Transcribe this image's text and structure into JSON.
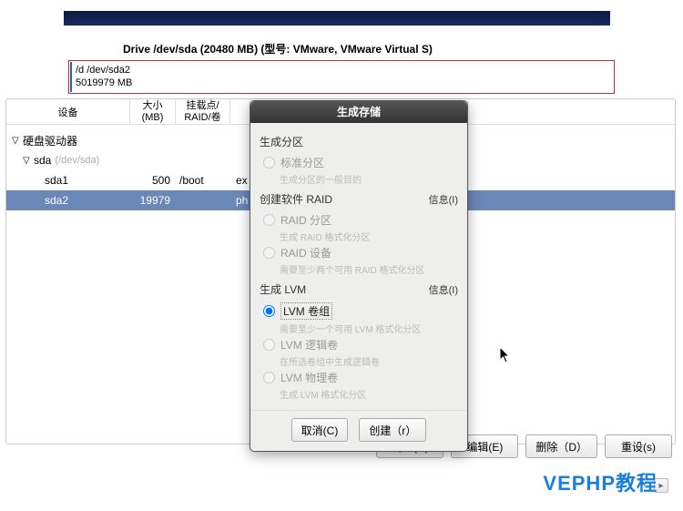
{
  "drive": {
    "title": "Drive /dev/sda (20480 MB) (型号: VMware, VMware Virtual S)",
    "line1": "/d /dev/sda2",
    "line2": "5019979 MB"
  },
  "columns": {
    "device": "设备",
    "size_l1": "大小",
    "size_l2": "(MB)",
    "mount_l1": "挂载点/",
    "mount_l2": "RAID/卷"
  },
  "tree": {
    "root": "硬盘驱动器",
    "sda": "sda",
    "sda_dev": "(/dev/sda)",
    "rows": [
      {
        "name": "sda1",
        "size": "500",
        "mount": "/boot",
        "type": "ex"
      },
      {
        "name": "sda2",
        "size": "19979",
        "mount": "",
        "type": "ph"
      }
    ]
  },
  "dialog": {
    "title": "生成存储",
    "sec1": "生成分区",
    "opt1": "标准分区",
    "opt1s": "生成分区的一般目的",
    "sec2": "创建软件 RAID",
    "info": "信息(I)",
    "opt2a": "RAID 分区",
    "opt2as": "生成 RAID 格式化分区",
    "opt2b": "RAID 设备",
    "opt2bs": "需要至少两个可用 RAID 格式化分区",
    "sec3": "生成 LVM",
    "opt3a": "LVM 卷组",
    "opt3as": "需要至少一个可用 LVM 格式化分区",
    "opt3b": "LVM 逻辑卷",
    "opt3bs": "在所选卷组中生成逻辑卷",
    "opt3c": "LVM 物理卷",
    "opt3cs": "生成 LVM 格式化分区",
    "cancel": "取消(C)",
    "create": "创建（r）"
  },
  "footer": {
    "create": "创建(C)",
    "edit": "编辑(E)",
    "delete": "删除（D）",
    "reset": "重设(s)"
  },
  "watermark": "VEPHP教程"
}
